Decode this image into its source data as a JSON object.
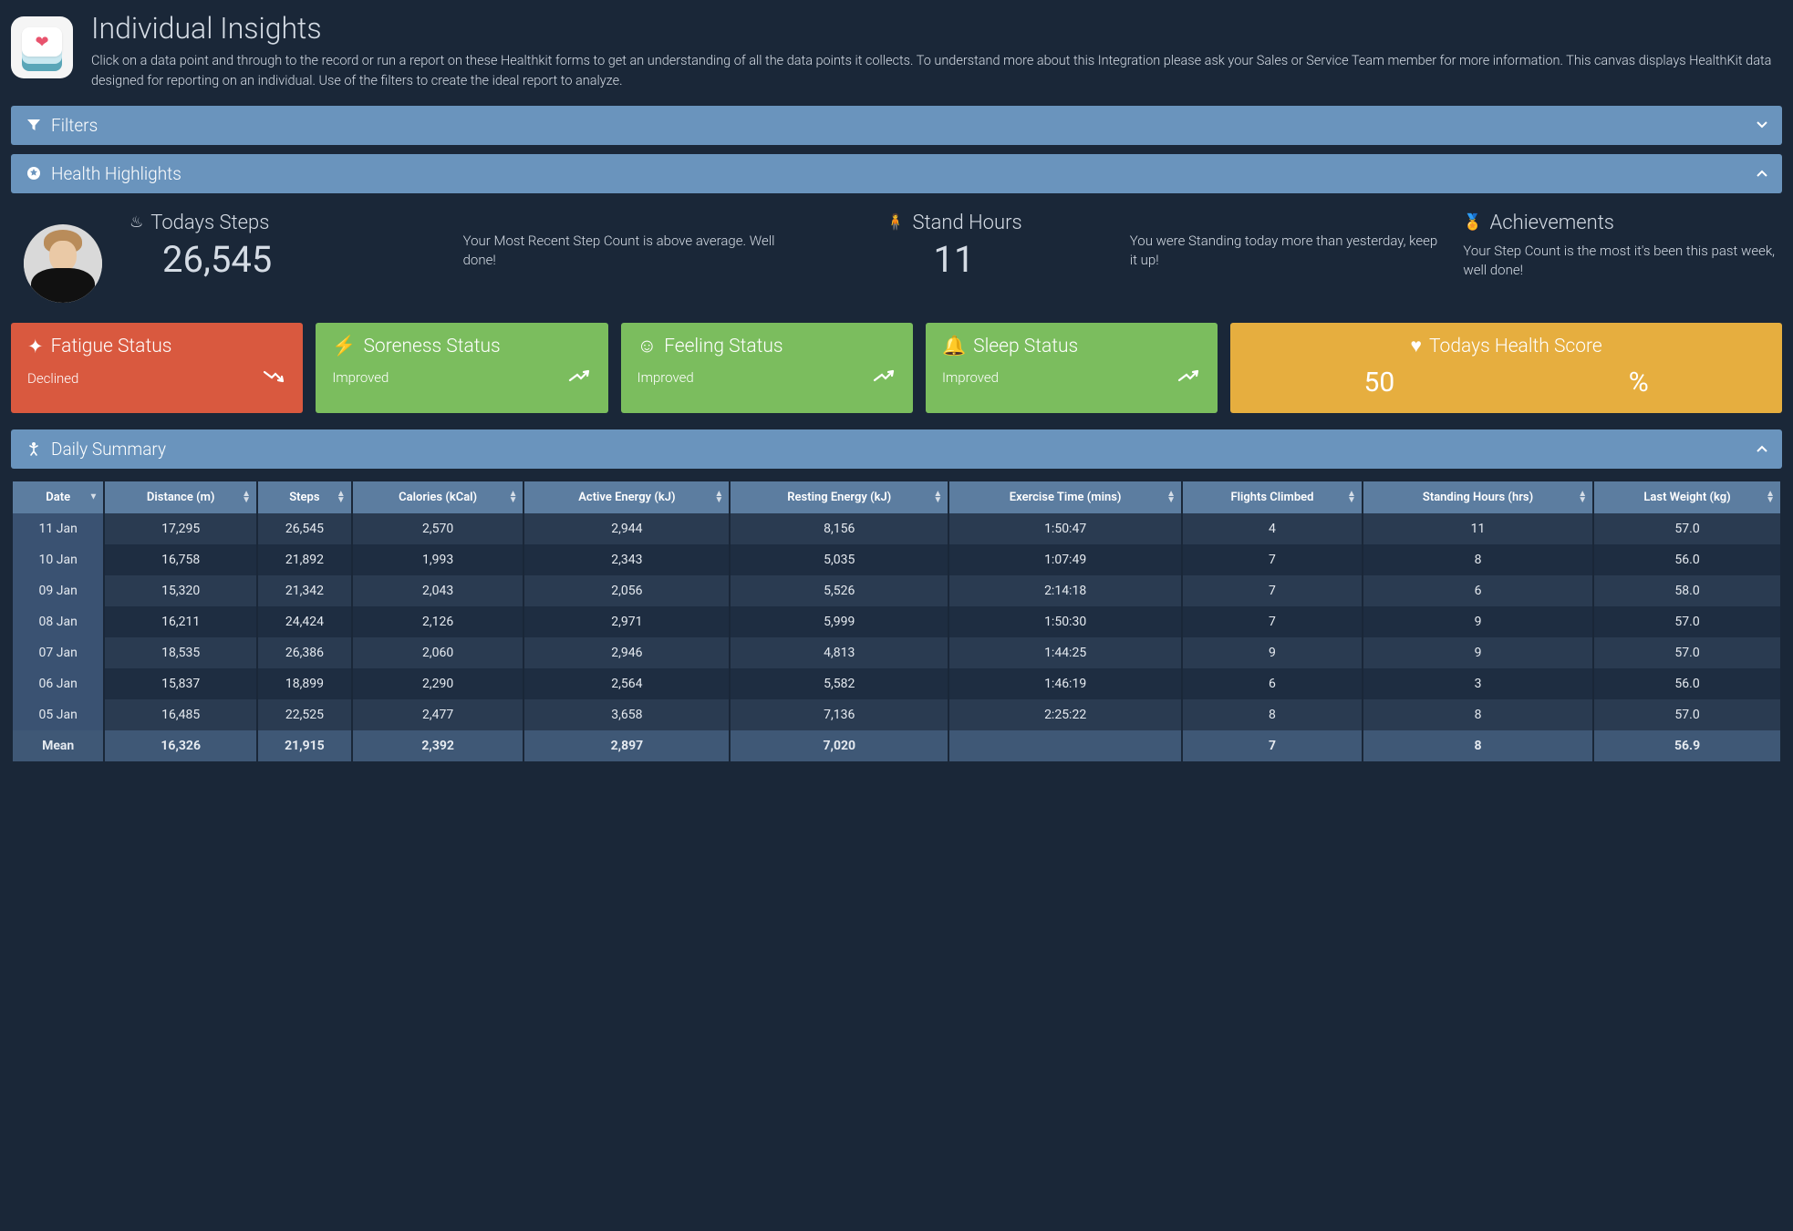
{
  "header": {
    "title": "Individual Insights",
    "description": "Click on a data point and through to the record or run a report on these Healthkit forms to get an understanding of all the data points it collects. To understand more about this Integration please ask your Sales or Service Team member for more information. This canvas displays HealthKit data designed for reporting on an individual. Use of the filters to create the ideal report to analyze."
  },
  "panels": {
    "filters": {
      "label": "Filters",
      "expanded": false
    },
    "highlights": {
      "label": "Health Highlights",
      "expanded": true
    },
    "daily_summary": {
      "label": "Daily Summary",
      "expanded": true
    }
  },
  "highlights": {
    "steps": {
      "label": "Todays Steps",
      "value": "26,545",
      "sub": "Your Most Recent Step Count is above average. Well done!"
    },
    "stand": {
      "label": "Stand Hours",
      "value": "11",
      "sub": "You were Standing today more than yesterday, keep it up!"
    },
    "achievements": {
      "label": "Achievements",
      "sub": "Your Step Count is the most it's been this past week, well done!"
    }
  },
  "status_cards": {
    "fatigue": {
      "title": "Fatigue Status",
      "value": "Declined",
      "trend": "down"
    },
    "soreness": {
      "title": "Soreness Status",
      "value": "Improved",
      "trend": "up"
    },
    "feeling": {
      "title": "Feeling Status",
      "value": "Improved",
      "trend": "up"
    },
    "sleep": {
      "title": "Sleep Status",
      "value": "Improved",
      "trend": "up"
    },
    "score": {
      "title": "Todays Health Score",
      "value": "50",
      "unit": "%"
    }
  },
  "table": {
    "columns": [
      "Date",
      "Distance (m)",
      "Steps",
      "Calories (kCal)",
      "Active Energy (kJ)",
      "Resting Energy (kJ)",
      "Exercise Time (mins)",
      "Flights Climbed",
      "Standing Hours (hrs)",
      "Last Weight (kg)"
    ],
    "rows": [
      {
        "date": "11 Jan",
        "distance": "17,295",
        "steps": "26,545",
        "calories": "2,570",
        "active": "2,944",
        "resting": "8,156",
        "exercise": "1:50:47",
        "flights": "4",
        "standing": "11",
        "weight": "57.0"
      },
      {
        "date": "10 Jan",
        "distance": "16,758",
        "steps": "21,892",
        "calories": "1,993",
        "active": "2,343",
        "resting": "5,035",
        "exercise": "1:07:49",
        "flights": "7",
        "standing": "8",
        "weight": "56.0"
      },
      {
        "date": "09 Jan",
        "distance": "15,320",
        "steps": "21,342",
        "calories": "2,043",
        "active": "2,056",
        "resting": "5,526",
        "exercise": "2:14:18",
        "flights": "7",
        "standing": "6",
        "weight": "58.0"
      },
      {
        "date": "08 Jan",
        "distance": "16,211",
        "steps": "24,424",
        "calories": "2,126",
        "active": "2,971",
        "resting": "5,999",
        "exercise": "1:50:30",
        "flights": "7",
        "standing": "9",
        "weight": "57.0"
      },
      {
        "date": "07 Jan",
        "distance": "18,535",
        "steps": "26,386",
        "calories": "2,060",
        "active": "2,946",
        "resting": "4,813",
        "exercise": "1:44:25",
        "flights": "9",
        "standing": "9",
        "weight": "57.0"
      },
      {
        "date": "06 Jan",
        "distance": "15,837",
        "steps": "18,899",
        "calories": "2,290",
        "active": "2,564",
        "resting": "5,582",
        "exercise": "1:46:19",
        "flights": "6",
        "standing": "3",
        "weight": "56.0"
      },
      {
        "date": "05 Jan",
        "distance": "16,485",
        "steps": "22,525",
        "calories": "2,477",
        "active": "3,658",
        "resting": "7,136",
        "exercise": "2:25:22",
        "flights": "8",
        "standing": "8",
        "weight": "57.0"
      }
    ],
    "mean": {
      "date": "Mean",
      "distance": "16,326",
      "steps": "21,915",
      "calories": "2,392",
      "active": "2,897",
      "resting": "7,020",
      "exercise": "",
      "flights": "7",
      "standing": "8",
      "weight": "56.9"
    }
  },
  "colors": {
    "panel_bar": "#6a94bd",
    "red": "#d9593f",
    "green": "#7bbd5e",
    "yellow": "#e6ae3f",
    "bg": "#1a2738"
  }
}
